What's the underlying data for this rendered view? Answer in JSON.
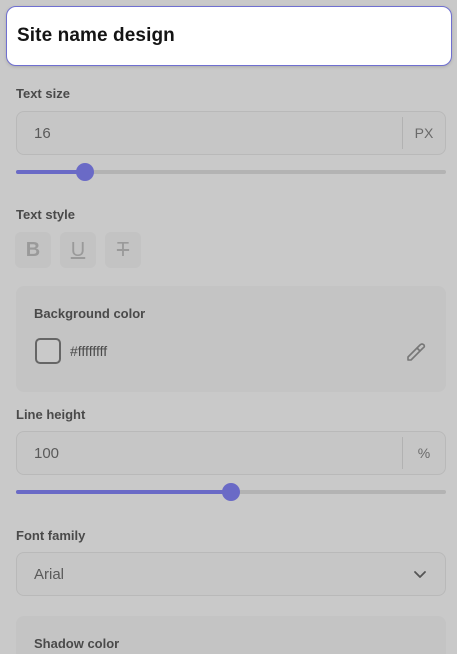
{
  "header": {
    "title": "Site name design"
  },
  "text_size": {
    "label": "Text size",
    "value": "16",
    "unit": "PX",
    "slider_fraction": 0.16
  },
  "text_style": {
    "label": "Text style",
    "bold": "B",
    "underline": "U",
    "strike": "T"
  },
  "background_color": {
    "label": "Background color",
    "value": "#ffffffff",
    "swatch_color": "#ffffff"
  },
  "line_height": {
    "label": "Line height",
    "value": "100",
    "unit": "%",
    "slider_fraction": 0.5
  },
  "font_family": {
    "label": "Font family",
    "selected": "Arial"
  },
  "shadow_color": {
    "label": "Shadow color"
  },
  "colors": {
    "accent": "#6a6ac6",
    "header_border": "#6f6fd0"
  }
}
